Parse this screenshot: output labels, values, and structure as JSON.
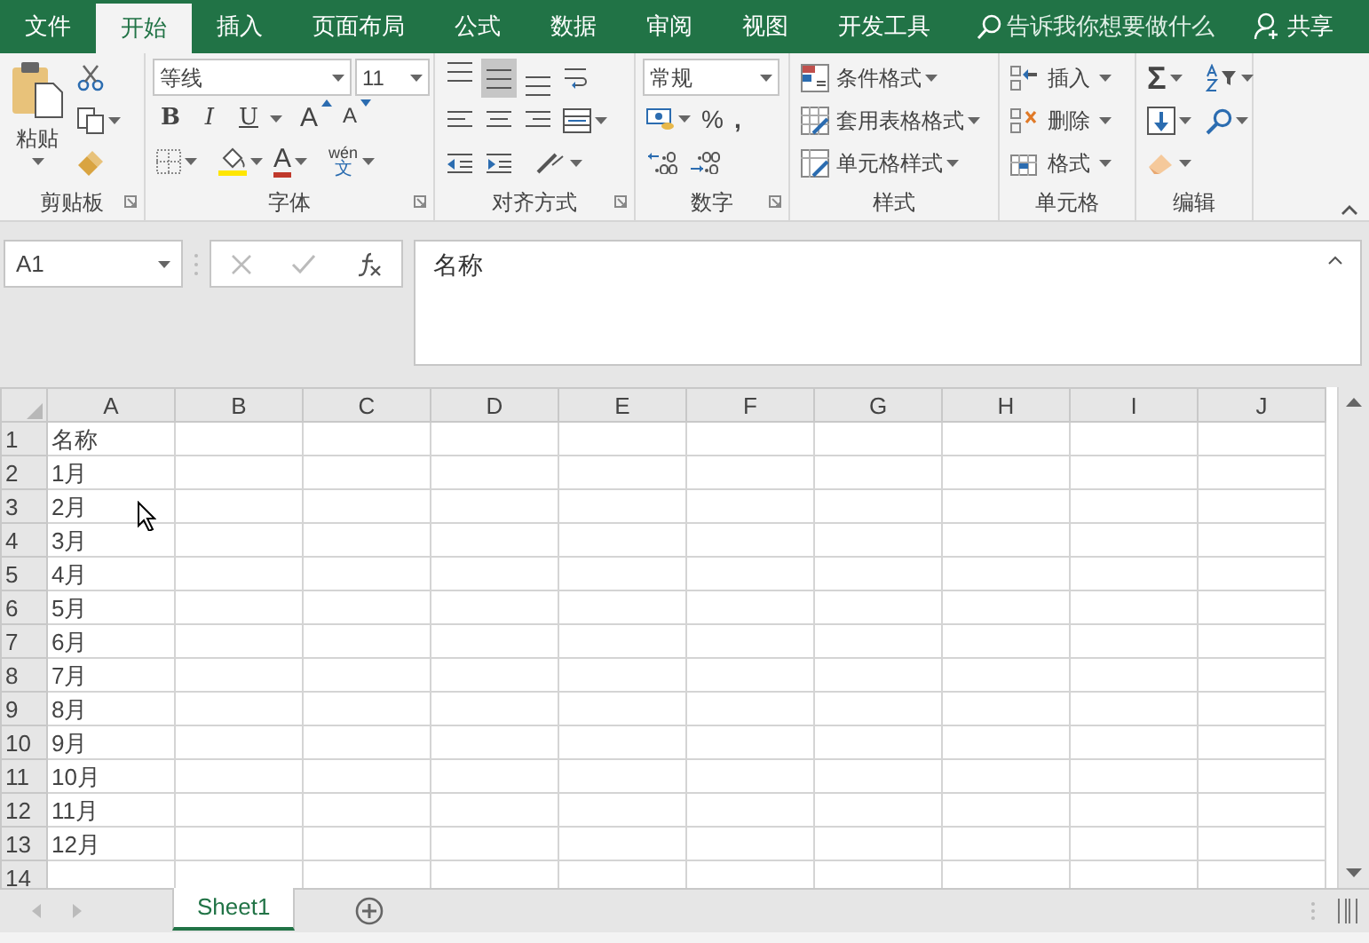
{
  "menu_tabs": [
    {
      "label": "文件",
      "selected": false
    },
    {
      "label": "开始",
      "selected": true
    },
    {
      "label": "插入",
      "selected": false
    },
    {
      "label": "页面布局",
      "selected": false
    },
    {
      "label": "公式",
      "selected": false
    },
    {
      "label": "数据",
      "selected": false
    },
    {
      "label": "审阅",
      "selected": false
    },
    {
      "label": "视图",
      "selected": false
    },
    {
      "label": "开发工具",
      "selected": false
    }
  ],
  "tell_me": "告诉我你想要做什么",
  "share": "共享",
  "ribbon": {
    "clipboard": {
      "label": "剪贴板",
      "paste": "粘贴"
    },
    "font": {
      "label": "字体",
      "font_name": "等线",
      "font_size": "11",
      "style_buttons": [
        "B",
        "I",
        "U"
      ],
      "grow": "A",
      "shrink": "A",
      "color_letter": "A",
      "phonetic_top": "wén",
      "phonetic_bottom": "文"
    },
    "alignment": {
      "label": "对齐方式",
      "vertical": [
        {
          "selected": false
        },
        {
          "selected": true
        },
        {
          "selected": false
        }
      ]
    },
    "number": {
      "label": "数字",
      "format": "常规",
      "percent": "%",
      "comma": ","
    },
    "styles": {
      "label": "样式",
      "buttons": [
        "条件格式",
        "套用表格格式",
        "单元格样式"
      ]
    },
    "cells": {
      "label": "单元格",
      "buttons": [
        "插入",
        "删除",
        "格式"
      ]
    },
    "editing": {
      "label": "编辑",
      "sum": "Σ"
    }
  },
  "name_box": "A1",
  "formula": "名称",
  "columns": [
    "A",
    "B",
    "C",
    "D",
    "E",
    "F",
    "G",
    "H",
    "I",
    "J"
  ],
  "rows": [
    {
      "number": "1",
      "cells": [
        "名称"
      ]
    },
    {
      "number": "2",
      "cells": [
        "1月"
      ]
    },
    {
      "number": "3",
      "cells": [
        "2月"
      ]
    },
    {
      "number": "4",
      "cells": [
        "3月"
      ]
    },
    {
      "number": "5",
      "cells": [
        "4月"
      ]
    },
    {
      "number": "6",
      "cells": [
        "5月"
      ]
    },
    {
      "number": "7",
      "cells": [
        "6月"
      ]
    },
    {
      "number": "8",
      "cells": [
        "7月"
      ]
    },
    {
      "number": "9",
      "cells": [
        "8月"
      ]
    },
    {
      "number": "10",
      "cells": [
        "9月"
      ]
    },
    {
      "number": "11",
      "cells": [
        "10月"
      ]
    },
    {
      "number": "12",
      "cells": [
        "11月"
      ]
    },
    {
      "number": "13",
      "cells": [
        "12月"
      ]
    },
    {
      "number": "14",
      "cells": []
    }
  ],
  "sheet_tabs": [
    {
      "label": "Sheet1",
      "selected": true
    }
  ]
}
